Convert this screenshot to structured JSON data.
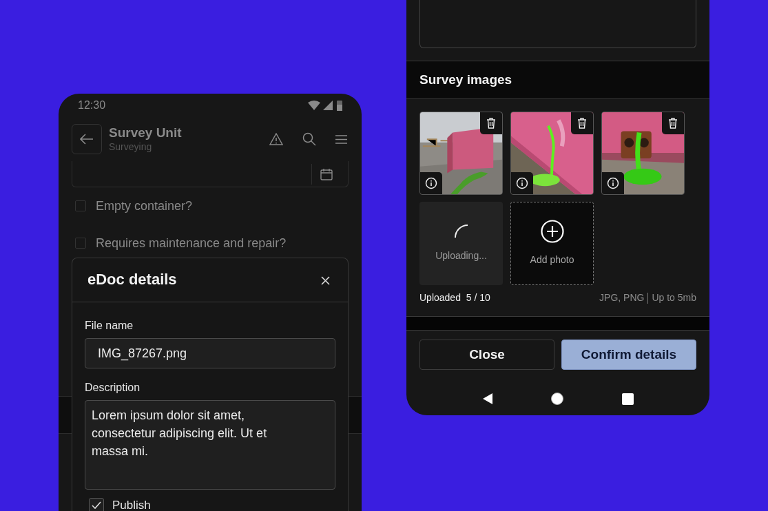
{
  "background_screen": {
    "status_bar": {
      "time": "12:30"
    },
    "header": {
      "title": "Survey Unit",
      "subtitle": "Surveying"
    },
    "checklist": [
      {
        "label": "Empty container?",
        "checked": false
      },
      {
        "label": "Requires maintenance and repair?",
        "checked": false
      }
    ]
  },
  "modal": {
    "title": "eDoc details",
    "fields": [
      {
        "kind": "input",
        "label": "File name",
        "value": "IMG_87267.png"
      },
      {
        "kind": "textarea",
        "label": "Description",
        "value": "Lorem ipsum dolor sit amet, consectetur adipiscing elit. Ut et massa mi."
      }
    ],
    "publish": {
      "label": "Publish",
      "checked": true
    }
  },
  "survey_images": {
    "title": "Survey images",
    "tiles": [
      {
        "kind": "picture"
      },
      {
        "kind": "picture"
      },
      {
        "kind": "picture"
      },
      {
        "kind": "uploading",
        "label": "Uploading..."
      },
      {
        "kind": "add",
        "label": "Add photo"
      }
    ],
    "uploaded_label": "Uploaded",
    "uploaded_count": "5 / 10",
    "formats": "JPG, PNG",
    "size_limit": "Up to 5mb"
  },
  "buttons": [
    {
      "label": "Close",
      "kind": "secondary"
    },
    {
      "label": "Confirm details",
      "kind": "primary"
    }
  ]
}
